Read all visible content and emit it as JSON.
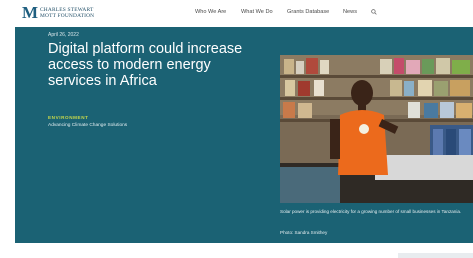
{
  "header": {
    "logo_line1": "CHARLES STEWART",
    "logo_line2": "MOTT FOUNDATION",
    "logo_mark": "M",
    "nav": [
      {
        "label": "Who We Are"
      },
      {
        "label": "What We Do"
      },
      {
        "label": "Grants Database"
      },
      {
        "label": "News"
      }
    ],
    "search_icon": "search-icon"
  },
  "hero": {
    "date": "April 26, 2022",
    "headline": "Digital platform could increase access to modern energy services in Africa",
    "category": "ENVIRONMENT",
    "subcategory": "Advancing Climate Change Solutions",
    "caption": "Solar power is providing electricity for a growing number of small businesses in Tanzania.",
    "credit": "Photo: Sandra Smithey"
  },
  "colors": {
    "hero_background": "#1b6274",
    "category_accent": "#c8d94a",
    "brand": "#1f5f80"
  }
}
